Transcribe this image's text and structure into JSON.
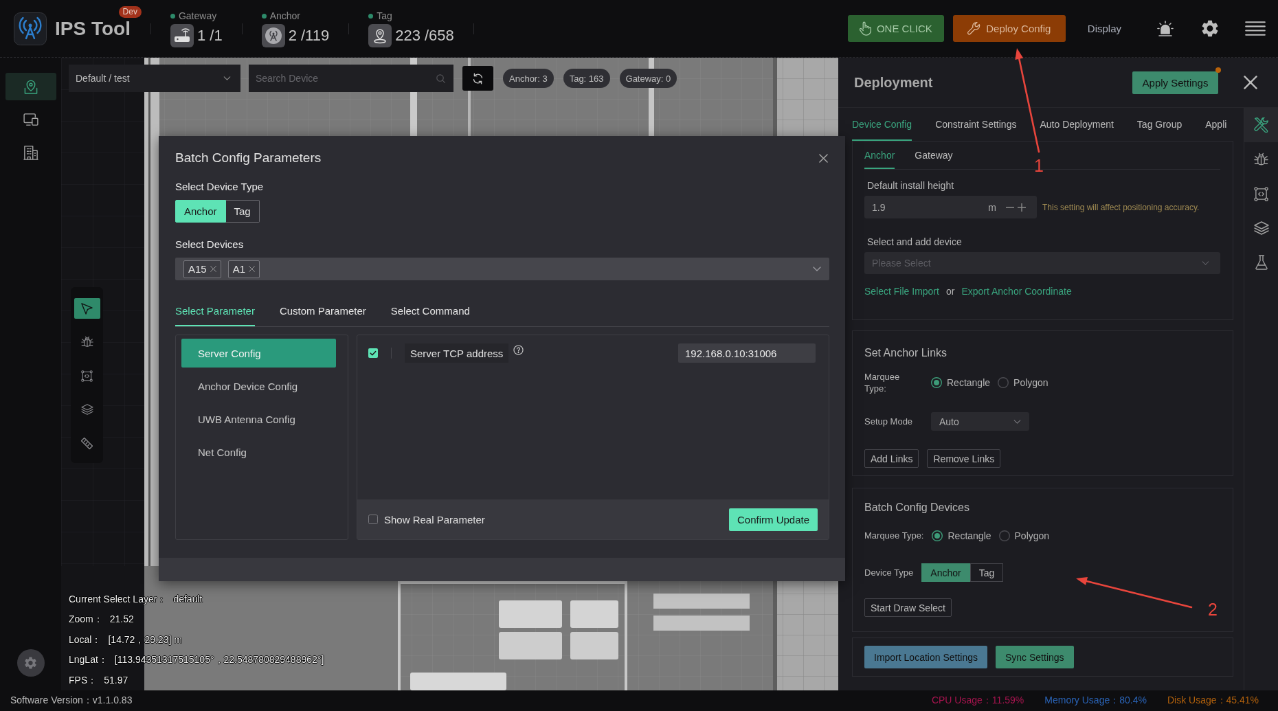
{
  "app": {
    "title": "IPS Tool",
    "badge": "Dev"
  },
  "device_stats": [
    {
      "kind": "gateway",
      "label": "Gateway",
      "value": "1 /1"
    },
    {
      "kind": "anchor",
      "label": "Anchor",
      "value": "2 /119"
    },
    {
      "kind": "tag",
      "label": "Tag",
      "value": "223 /658"
    }
  ],
  "header_actions": [
    {
      "kind": "one-click",
      "label": "ONE CLICK"
    },
    {
      "kind": "deploy",
      "label": "Deploy Config"
    },
    {
      "kind": "link",
      "label": "Display"
    }
  ],
  "sidebar": {
    "items": [
      {
        "kind": "map",
        "selected": true
      },
      {
        "kind": "devices",
        "selected": false
      },
      {
        "kind": "building",
        "selected": false
      }
    ]
  },
  "map_toolbar": {
    "layer_select": {
      "value": "Default / test"
    },
    "search": {
      "placeholder": "Search Device"
    },
    "counts": [
      "Anchor: 3",
      "Tag: 163",
      "Gateway: 0"
    ]
  },
  "map_tools": [
    {
      "kind": "pointer",
      "selected": true
    },
    {
      "kind": "bug",
      "selected": false
    },
    {
      "kind": "frame",
      "selected": false
    },
    {
      "kind": "layers",
      "selected": false
    },
    {
      "kind": "ruler",
      "selected": false
    }
  ],
  "map_info": [
    {
      "label": "Current Select Layer：",
      "value": "default"
    },
    {
      "label": "Zoom：",
      "value": "21.52"
    },
    {
      "label": "Local：",
      "value": "[14.72，29.23] m"
    },
    {
      "label": "LngLat：",
      "value": "[113.94351317515105°，22.548780829488962°]"
    },
    {
      "label": "FPS：",
      "value": "51.97"
    }
  ],
  "modal": {
    "title": "Batch Config Parameters",
    "device_type": {
      "label": "Select Device Type",
      "options": [
        {
          "label": "Anchor",
          "selected": true
        },
        {
          "label": "Tag",
          "selected": false
        }
      ]
    },
    "devices": {
      "label": "Select Devices",
      "tags": [
        "A15",
        "A1"
      ]
    },
    "tabs": [
      {
        "label": "Select Parameter",
        "selected": true
      },
      {
        "label": "Custom Parameter",
        "selected": false
      },
      {
        "label": "Select Command",
        "selected": false
      }
    ],
    "categories": [
      {
        "label": "Server Config",
        "selected": true
      },
      {
        "label": "Anchor Device Config",
        "selected": false
      },
      {
        "label": "UWB Antenna Config",
        "selected": false
      },
      {
        "label": "Net Config",
        "selected": false
      }
    ],
    "parameters": [
      {
        "label": "Server TCP address",
        "checked": true,
        "value": "192.168.0.10:31006"
      }
    ],
    "show_real": {
      "label": "Show Real Parameter",
      "checked": false
    },
    "confirm_button": "Confirm Update"
  },
  "deployment_panel": {
    "title": "Deployment",
    "apply_button": {
      "label": "Apply Settings",
      "modified": true
    },
    "tabs": [
      {
        "label": "Device Config",
        "selected": true
      },
      {
        "label": "Constraint Settings",
        "selected": false
      },
      {
        "label": "Auto Deployment",
        "selected": false
      },
      {
        "label": "Tag Group",
        "selected": false
      },
      {
        "label": "Appli",
        "selected": false
      }
    ],
    "side_tools": [
      {
        "kind": "tools",
        "selected": true
      },
      {
        "kind": "bug",
        "selected": false
      },
      {
        "kind": "frame",
        "selected": false
      },
      {
        "kind": "layers",
        "selected": false
      },
      {
        "kind": "flask",
        "selected": false
      }
    ],
    "device_config": {
      "subtabs": [
        {
          "label": "Anchor",
          "selected": true
        },
        {
          "label": "Gateway",
          "selected": false
        }
      ],
      "install_height": {
        "label": "Default install height",
        "value": "1.9",
        "unit": "m",
        "hint": "This setting will affect positioning accuracy."
      },
      "add_device": {
        "label": "Select and add device",
        "placeholder": "Please Select"
      },
      "links": [
        {
          "kind": "link",
          "label": "Select File Import"
        },
        {
          "kind": "text",
          "label": "or"
        },
        {
          "kind": "link",
          "label": "Export Anchor Coordinate"
        }
      ]
    },
    "anchor_links": {
      "title": "Set Anchor Links",
      "marquee": {
        "label": "Marquee Type:",
        "options": [
          {
            "label": "Rectangle",
            "selected": true
          },
          {
            "label": "Polygon",
            "selected": false
          }
        ]
      },
      "setup_mode": {
        "label": "Setup Mode",
        "value": "Auto"
      },
      "buttons": [
        "Add Links",
        "Remove Links"
      ]
    },
    "batch_devices": {
      "title": "Batch Config Devices",
      "marquee": {
        "label": "Marquee Type:",
        "options": [
          {
            "label": "Rectangle",
            "selected": true
          },
          {
            "label": "Polygon",
            "selected": false
          }
        ]
      },
      "device_type": {
        "label": "Device Type",
        "options": [
          {
            "label": "Anchor",
            "selected": true
          },
          {
            "label": "Tag",
            "selected": false
          }
        ]
      },
      "button": "Start Draw Select"
    },
    "footer_buttons": [
      {
        "kind": "info",
        "label": "Import Location Settings"
      },
      {
        "kind": "primary",
        "label": "Sync Settings"
      }
    ]
  },
  "status_bar": {
    "version": "Software Version：v1.1.0.83",
    "metrics": [
      {
        "label": "CPU Usage：",
        "value": "11.59%",
        "color": "#a8144f"
      },
      {
        "label": "Memory Usage：",
        "value": "80.4%",
        "color": "#2a64b8"
      },
      {
        "label": "Disk Usage：",
        "value": "45.41%",
        "color": "#b0600c"
      }
    ]
  },
  "annotations": [
    {
      "label": "1"
    },
    {
      "label": "2"
    }
  ]
}
